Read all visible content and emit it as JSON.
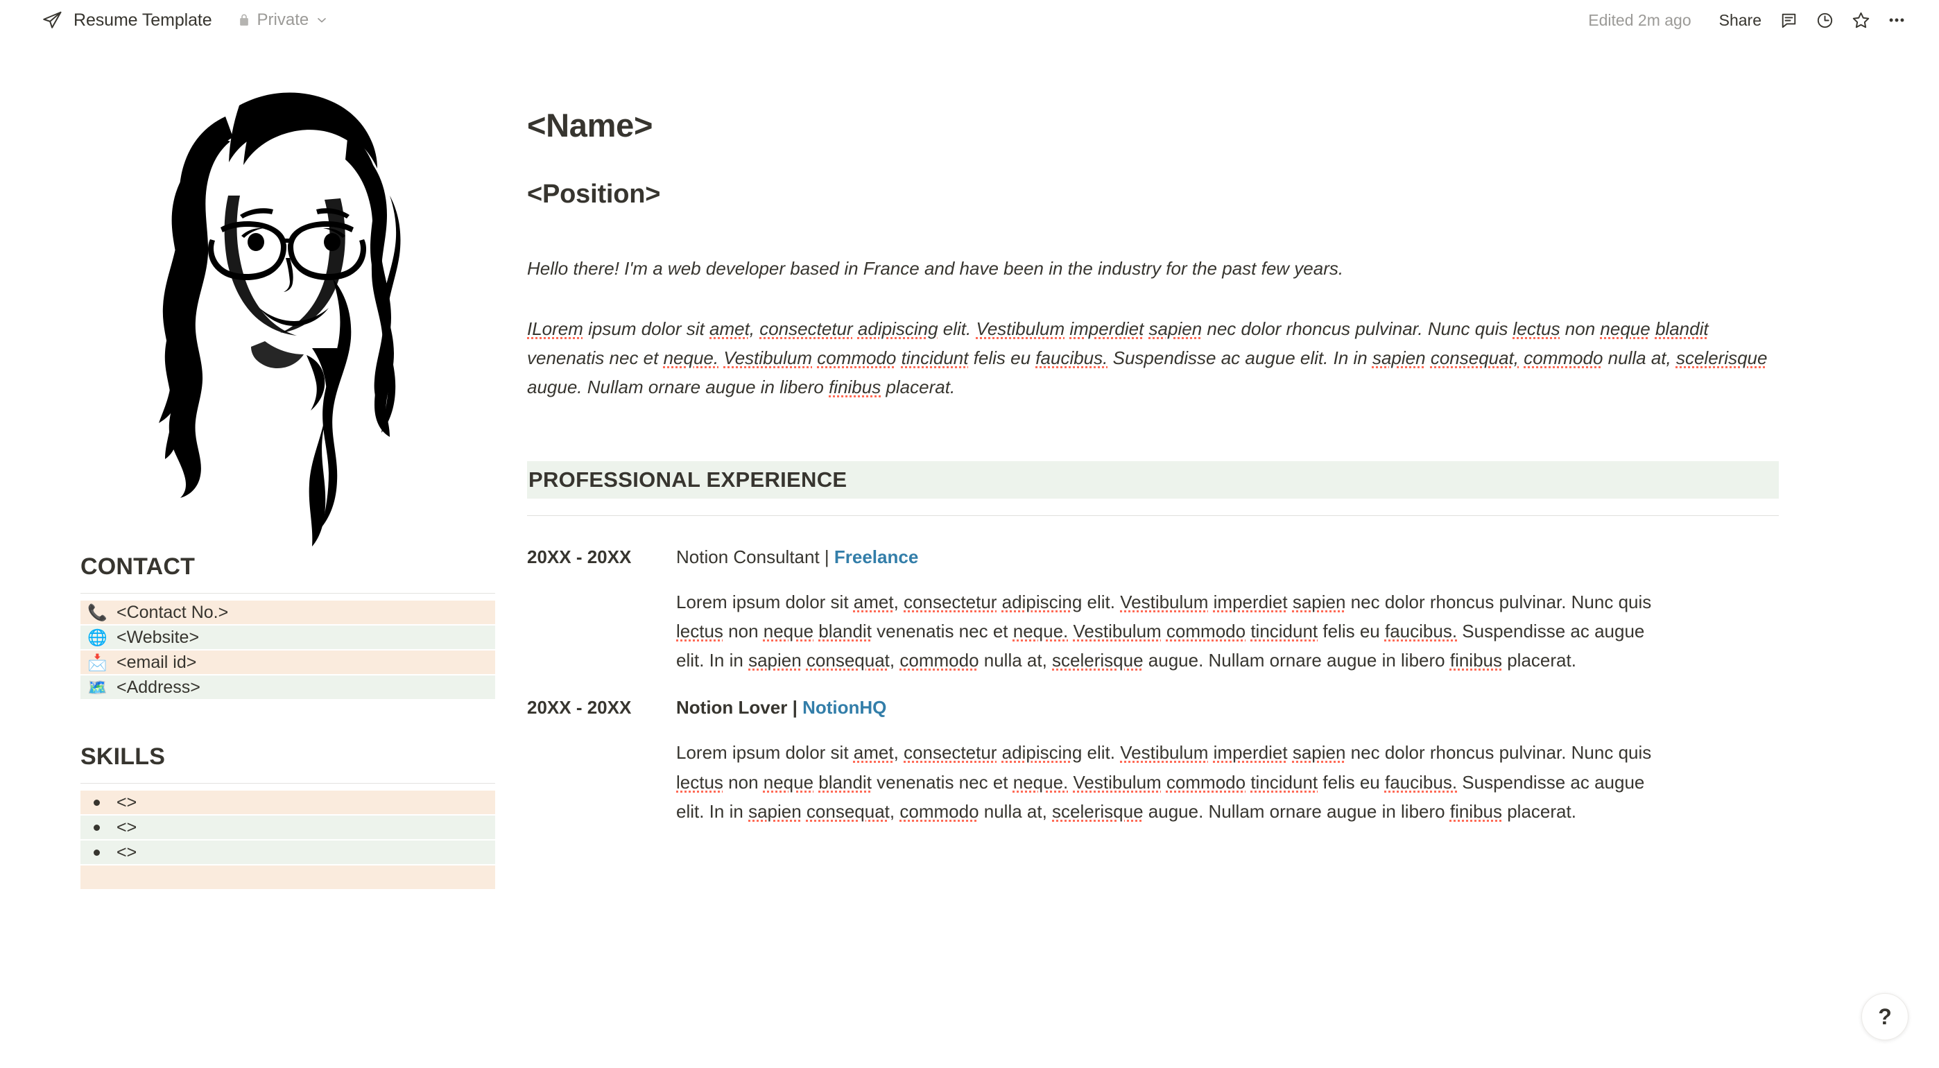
{
  "topbar": {
    "plane_icon": "paper-plane-icon",
    "title": "Resume Template",
    "lock_icon": "lock-icon",
    "privacy": "Private",
    "chevron_icon": "chevron-down-icon",
    "edited": "Edited 2m ago",
    "share": "Share",
    "comment_icon": "comment-icon",
    "history_icon": "clock-history-icon",
    "favorite_icon": "star-icon",
    "more_icon": "more-horizontal-icon"
  },
  "colors": {
    "accent_red": "#EB5757",
    "peach": "#FAEBDD",
    "mint": "#EDF3EC",
    "link_blue": "#337EA9",
    "text": "#37352F",
    "muted": "#9B9A97",
    "spell_underline": "#FF6A55"
  },
  "sidebar": {
    "portrait_alt": "portrait-illustration",
    "contact": {
      "heading": "CONTACT",
      "items": [
        {
          "emoji": "📞",
          "icon_name": "phone-icon",
          "label": "<Contact No.>",
          "bg": "peach"
        },
        {
          "emoji": "🌐",
          "icon_name": "globe-icon",
          "label": "<Website>",
          "bg": "mint"
        },
        {
          "emoji": "📩",
          "icon_name": "email-icon",
          "label": "<email id>",
          "bg": "peach"
        },
        {
          "emoji": "🗺️",
          "icon_name": "map-icon",
          "label": "<Address>",
          "bg": "mint"
        }
      ]
    },
    "skills": {
      "heading": "SKILLS",
      "items": [
        {
          "label": "<>",
          "bg": "peach"
        },
        {
          "label": "<>",
          "bg": "mint"
        },
        {
          "label": "<>",
          "bg": "mint"
        },
        {
          "label": "",
          "bg": "peach"
        }
      ]
    }
  },
  "main": {
    "name": "<Name>",
    "position": "<Position>",
    "intro_line": "Hello there! I'm a web developer based in France and have been in the industry for the past few years.",
    "intro_paragraph": "ILorem ipsum dolor sit amet, consectetur adipiscing elit. Vestibulum imperdiet sapien nec dolor rhoncus pulvinar. Nunc quis lectus non neque blandit venenatis nec et neque. Vestibulum commodo tincidunt felis eu faucibus. Suspendisse ac augue elit. In in sapien consequat, commodo nulla at, scelerisque augue. Nullam ornare augue in libero finibus placerat.",
    "section_heading": "PROFESSIONAL EXPERIENCE",
    "experience": [
      {
        "dates": "20XX - 20XX",
        "role": "Notion Consultant",
        "separator": " | ",
        "company": "Freelance",
        "role_bold": false,
        "description": "Lorem ipsum dolor sit amet, consectetur adipiscing elit. Vestibulum imperdiet sapien nec dolor rhoncus pulvinar. Nunc quis lectus non neque blandit venenatis nec et neque. Vestibulum commodo tincidunt felis eu faucibus. Suspendisse ac augue elit. In in sapien consequat, commodo nulla at, scelerisque augue. Nullam ornare augue in libero finibus placerat."
      },
      {
        "dates": "20XX - 20XX",
        "role": "Notion Lover",
        "separator": " | ",
        "company": "NotionHQ",
        "role_bold": true,
        "description": "Lorem ipsum dolor sit amet, consectetur adipiscing elit. Vestibulum imperdiet sapien nec dolor rhoncus pulvinar. Nunc quis lectus non neque blandit venenatis nec et neque. Vestibulum commodo tincidunt felis eu faucibus. Suspendisse ac augue elit. In in sapien consequat, commodo nulla at, scelerisque augue. Nullam ornare augue in libero finibus placerat."
      }
    ]
  },
  "help": {
    "label": "?",
    "icon_name": "question-mark-icon"
  }
}
